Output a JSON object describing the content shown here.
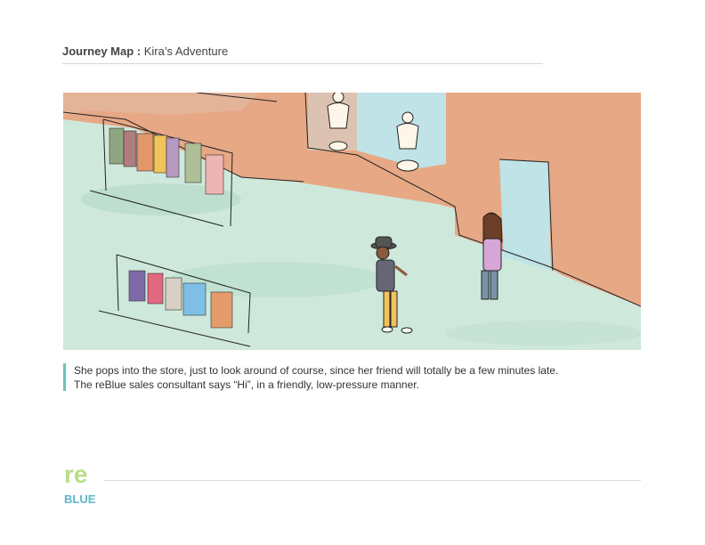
{
  "header": {
    "label": "Journey Map :",
    "title": "Kira’s Adventure"
  },
  "caption": {
    "text": "She pops into the store, just to look around of course, since her friend will totally be a few minutes late. The reBlue sales consultant says “Hi”, in a friendly, low-pressure manner."
  },
  "logo": {
    "top": "re",
    "bottom": "BLUE"
  },
  "colors": {
    "accent": "#6cc3b6",
    "floor": "#cfe8dc",
    "wall": "#e9a27d",
    "glass": "#bfe3e6"
  }
}
